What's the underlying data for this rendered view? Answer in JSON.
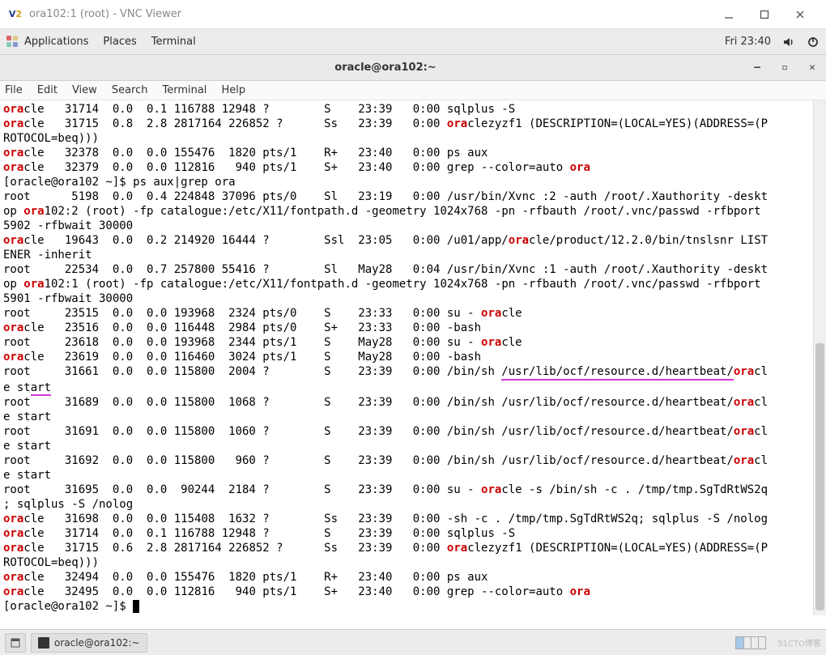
{
  "vnc": {
    "title": "ora102:1 (root) - VNC Viewer"
  },
  "gnome": {
    "applications": "Applications",
    "places": "Places",
    "terminal": "Terminal",
    "clock": "Fri 23:40"
  },
  "term": {
    "title": "oracle@ora102:~",
    "menu": {
      "file": "File",
      "edit": "Edit",
      "view": "View",
      "search": "Search",
      "terminal": "Terminal",
      "help": "Help"
    }
  },
  "task": {
    "item": "oracle@ora102:~"
  },
  "watermark": "51CTO博客",
  "lines": [
    [
      [
        "ora",
        "h"
      ],
      [
        "cle   31714  0.0  0.1 116788 12948 ?        S    23:39   0:00 sqlplus -S",
        "n"
      ]
    ],
    [
      [
        "ora",
        "h"
      ],
      [
        "cle   31715  0.8  2.8 2817164 226852 ?      Ss   23:39   0:00 ",
        "n"
      ],
      [
        "ora",
        "h"
      ],
      [
        "clezyzf1 (DESCRIPTION=(LOCAL=YES)(ADDRESS=(P",
        "n"
      ]
    ],
    [
      [
        "ROTOCOL=beq)))",
        "n"
      ]
    ],
    [
      [
        "ora",
        "h"
      ],
      [
        "cle   32378  0.0  0.0 155476  1820 pts/1    R+   23:40   0:00 ps aux",
        "n"
      ]
    ],
    [
      [
        "ora",
        "h"
      ],
      [
        "cle   32379  0.0  0.0 112816   940 pts/1    S+   23:40   0:00 grep --color=auto ",
        "n"
      ],
      [
        "ora",
        "h"
      ]
    ],
    [
      [
        "[oracle@ora102 ~]$ ps aux|grep ora",
        "n"
      ]
    ],
    [
      [
        "root      5198  0.0  0.4 224848 37096 pts/0    Sl   23:19   0:00 /usr/bin/Xvnc :2 -auth /root/.Xauthority -deskt",
        "n"
      ]
    ],
    [
      [
        "op ",
        "n"
      ],
      [
        "ora",
        "h"
      ],
      [
        "102:2 (root) -fp catalogue:/etc/X11/fontpath.d -geometry 1024x768 -pn -rfbauth /root/.vnc/passwd -rfbport ",
        "n"
      ]
    ],
    [
      [
        "5902 -rfbwait 30000",
        "n"
      ]
    ],
    [
      [
        "ora",
        "h"
      ],
      [
        "cle   19643  0.0  0.2 214920 16444 ?        Ssl  23:05   0:00 /u01/app/",
        "n"
      ],
      [
        "ora",
        "h"
      ],
      [
        "cle/product/12.2.0/bin/tnslsnr LIST",
        "n"
      ]
    ],
    [
      [
        "ENER -inherit",
        "n"
      ]
    ],
    [
      [
        "root     22534  0.0  0.7 257800 55416 ?        Sl   May28   0:04 /usr/bin/Xvnc :1 -auth /root/.Xauthority -deskt",
        "n"
      ]
    ],
    [
      [
        "op ",
        "n"
      ],
      [
        "ora",
        "h"
      ],
      [
        "102:1 (root) -fp catalogue:/etc/X11/fontpath.d -geometry 1024x768 -pn -rfbauth /root/.vnc/passwd -rfbport ",
        "n"
      ]
    ],
    [
      [
        "5901 -rfbwait 30000",
        "n"
      ]
    ],
    [
      [
        "root     23515  0.0  0.0 193968  2324 pts/0    S    23:33   0:00 su - ",
        "n"
      ],
      [
        "ora",
        "h"
      ],
      [
        "cle",
        "n"
      ]
    ],
    [
      [
        "ora",
        "h"
      ],
      [
        "cle   23516  0.0  0.0 116448  2984 pts/0    S+   23:33   0:00 -bash",
        "n"
      ]
    ],
    [
      [
        "root     23618  0.0  0.0 193968  2344 pts/1    S    May28   0:00 su - ",
        "n"
      ],
      [
        "ora",
        "h"
      ],
      [
        "cle",
        "n"
      ]
    ],
    [
      [
        "ora",
        "h"
      ],
      [
        "cle   23619  0.0  0.0 116460  3024 pts/1    S    May28   0:00 -bash",
        "n"
      ]
    ],
    [
      [
        "root     31661  0.0  0.0 115800  2004 ?        S    23:39   0:00 /bin/sh ",
        "n"
      ],
      [
        "/usr/lib/ocf/resource.d/heartbeat/",
        "u"
      ],
      [
        "ora",
        "h"
      ],
      [
        "cl",
        "n"
      ]
    ],
    [
      [
        "e st",
        "n"
      ],
      [
        "art",
        "us"
      ]
    ],
    [
      [
        "root     31689  0.0  0.0 115800  1068 ?        S    23:39   0:00 /bin/sh /usr/lib/ocf/resource.d/heartbeat/",
        "n"
      ],
      [
        "ora",
        "h"
      ],
      [
        "cl",
        "n"
      ]
    ],
    [
      [
        "e start",
        "n"
      ]
    ],
    [
      [
        "root     31691  0.0  0.0 115800  1060 ?        S    23:39   0:00 /bin/sh /usr/lib/ocf/resource.d/heartbeat/",
        "n"
      ],
      [
        "ora",
        "h"
      ],
      [
        "cl",
        "n"
      ]
    ],
    [
      [
        "e start",
        "n"
      ]
    ],
    [
      [
        "root     31692  0.0  0.0 115800   960 ?        S    23:39   0:00 /bin/sh /usr/lib/ocf/resource.d/heartbeat/",
        "n"
      ],
      [
        "ora",
        "h"
      ],
      [
        "cl",
        "n"
      ]
    ],
    [
      [
        "e start",
        "n"
      ]
    ],
    [
      [
        "root     31695  0.0  0.0  90244  2184 ?        S    23:39   0:00 su - ",
        "n"
      ],
      [
        "ora",
        "h"
      ],
      [
        "cle -s /bin/sh -c . /tmp/tmp.SgTdRtWS2q",
        "n"
      ]
    ],
    [
      [
        "; sqlplus -S /nolog",
        "n"
      ]
    ],
    [
      [
        "ora",
        "h"
      ],
      [
        "cle   31698  0.0  0.0 115408  1632 ?        Ss   23:39   0:00 -sh -c . /tmp/tmp.SgTdRtWS2q; sqlplus -S /nolog",
        "n"
      ]
    ],
    [
      [
        "ora",
        "h"
      ],
      [
        "cle   31714  0.0  0.1 116788 12948 ?        S    23:39   0:00 sqlplus -S",
        "n"
      ]
    ],
    [
      [
        "ora",
        "h"
      ],
      [
        "cle   31715  0.6  2.8 2817164 226852 ?      Ss   23:39   0:00 ",
        "n"
      ],
      [
        "ora",
        "h"
      ],
      [
        "clezyzf1 (DESCRIPTION=(LOCAL=YES)(ADDRESS=(P",
        "n"
      ]
    ],
    [
      [
        "ROTOCOL=beq)))",
        "n"
      ]
    ],
    [
      [
        "ora",
        "h"
      ],
      [
        "cle   32494  0.0  0.0 155476  1820 pts/1    R+   23:40   0:00 ps aux",
        "n"
      ]
    ],
    [
      [
        "ora",
        "h"
      ],
      [
        "cle   32495  0.0  0.0 112816   940 pts/1    S+   23:40   0:00 grep --color=auto ",
        "n"
      ],
      [
        "ora",
        "h"
      ]
    ],
    [
      [
        "[oracle@ora102 ~]$ ",
        "n"
      ],
      [
        "",
        "cursor"
      ]
    ]
  ]
}
